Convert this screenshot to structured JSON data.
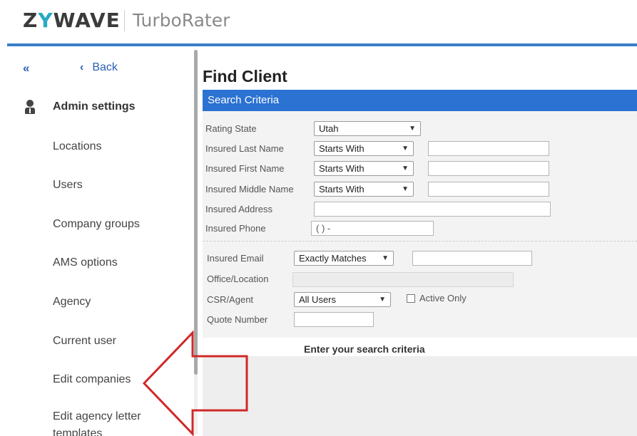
{
  "header": {
    "logo_pre": "Z",
    "logo_y": "Y",
    "logo_post": "WAVE",
    "product": "TurboRater"
  },
  "sidebar": {
    "collapse": "«",
    "back_label": "Back",
    "section_title": "Admin settings",
    "items": [
      {
        "label": "Locations"
      },
      {
        "label": "Users"
      },
      {
        "label": "Company groups"
      },
      {
        "label": "AMS options"
      },
      {
        "label": "Agency"
      },
      {
        "label": "Current user"
      },
      {
        "label": "Edit companies"
      },
      {
        "label": "Edit agency letter"
      },
      {
        "label": "templates"
      }
    ]
  },
  "main": {
    "title": "Find Client",
    "panel_title": "Search Criteria",
    "fields": {
      "rating_state": {
        "label": "Rating State",
        "value": "Utah"
      },
      "last_name": {
        "label": "Insured Last Name",
        "match": "Starts With",
        "value": ""
      },
      "first_name": {
        "label": "Insured First Name",
        "match": "Starts With",
        "value": ""
      },
      "middle_name": {
        "label": "Insured Middle Name",
        "match": "Starts With",
        "value": ""
      },
      "address": {
        "label": "Insured Address",
        "value": ""
      },
      "phone": {
        "label": "Insured Phone",
        "value": "(  )   -"
      },
      "email": {
        "label": "Insured Email",
        "match": "Exactly Matches",
        "value": ""
      },
      "office": {
        "label": "Office/Location",
        "value": ""
      },
      "csr": {
        "label": "CSR/Agent",
        "value": "All Users"
      },
      "active_only": {
        "label": "Active Only",
        "checked": false
      },
      "quote_number": {
        "label": "Quote Number",
        "value": ""
      }
    },
    "hint": "Enter your search criteria"
  },
  "colors": {
    "brand_blue": "#3a7fc8",
    "panel_header": "#2b72d2",
    "arrow_red": "#d02828",
    "logo_accent": "#27a9c4"
  }
}
